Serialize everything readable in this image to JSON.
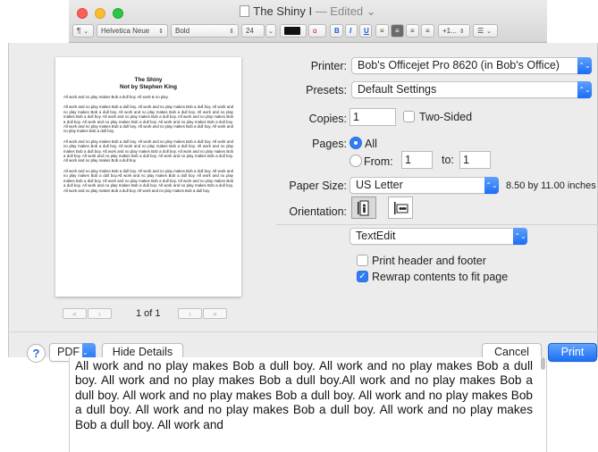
{
  "window": {
    "title": "The Shiny I",
    "title_suffix": "— Edited",
    "chevron": "⌄"
  },
  "format_bar": {
    "paragraph_style": "¶",
    "font_family": "Helvetica Neue",
    "font_style": "Bold",
    "font_size": "24",
    "bold": "B",
    "italic": "I",
    "underline": "U",
    "spacing": "+1...",
    "list": "☰"
  },
  "preview": {
    "title": "The Shiny",
    "subtitle": "Not by Stephen King",
    "first_line": "All work and no play makes Bob a dull boy. All work & no play.",
    "paragraphs": [
      "All work and no play makes Bob a dull boy. All work and no play makes Bob a dull boy. All work and no play makes Bob a dull boy. All work and no play makes Bob a dull boy. All work and no play makes Bob a dull boy. All work and no play makes Bob a dull boy. All work and no play makes Bob a dull boy. All work and no play makes Bob a dull boy. All work and no play makes Bob a dull boy. All work and no play makes Bob a dull boy. All work and no play makes Bob a dull boy. All work and no play makes Bob a dull boy.",
      "All work and no play makes Bob a dull boy. All work and no play makes Bob a dull boy. All work and no play makes Bob a dull boy. All work and no play makes Bob a dull boy. All work and no play makes Bob a dull boy. All work and no play makes Bob a dull boy. All work and no play makes Bob a dull boy. All work and no play makes Bob a dull boy. All work and no play makes Bob a dull boy. All work and no play makes Bob a dull boy.",
      "All work and no play makes Bob a dull boy. All work and no play makes Bob a dull boy. All work and no play makes Bob a dull boy.All work and no play makes Bob a dull boy. All work and no play makes Bob a dull boy. All work and no play makes Bob a dull boy. All work and no play makes Bob a dull boy. All work and no play makes Bob a dull boy. All work and no play makes Bob a dull boy. All work and no play makes Bob a dull boy. All work and no play makes Bob a dull boy."
    ],
    "page_label": "1 of 1",
    "first": "«",
    "prev": "‹",
    "next": "›",
    "last": "»"
  },
  "settings": {
    "printer_label": "Printer:",
    "printer_value": "Bob's Officejet Pro 8620 (in Bob's Office)",
    "presets_label": "Presets:",
    "presets_value": "Default Settings",
    "copies_label": "Copies:",
    "copies_value": "1",
    "two_sided_label": "Two-Sided",
    "pages_label": "Pages:",
    "pages_all": "All",
    "pages_from": "From:",
    "pages_from_value": "1",
    "pages_to": "to:",
    "pages_to_value": "1",
    "paper_size_label": "Paper Size:",
    "paper_size_value": "US Letter",
    "paper_dimensions": "8.50 by 11.00 inches",
    "orientation_label": "Orientation:",
    "app_section_value": "TextEdit",
    "print_header_label": "Print header and footer",
    "rewrap_label": "Rewrap contents to fit page",
    "check_mark": "✓",
    "popup_arrow": "⌃⌄"
  },
  "actions": {
    "help": "?",
    "pdf": "PDF",
    "pdf_arrow": "⌄",
    "hide_details": "Hide Details",
    "cancel": "Cancel",
    "print": "Print"
  },
  "document": {
    "body": "All work and no play makes Bob a dull boy. All work and no play makes Bob a dull boy. All work and no play makes Bob a dull boy.All work and no play makes Bob a dull boy. All work and no play makes Bob a dull boy. All work and no play makes Bob a dull boy. All work and no play makes Bob a dull boy. All work and no play makes Bob a dull boy. All work and"
  }
}
